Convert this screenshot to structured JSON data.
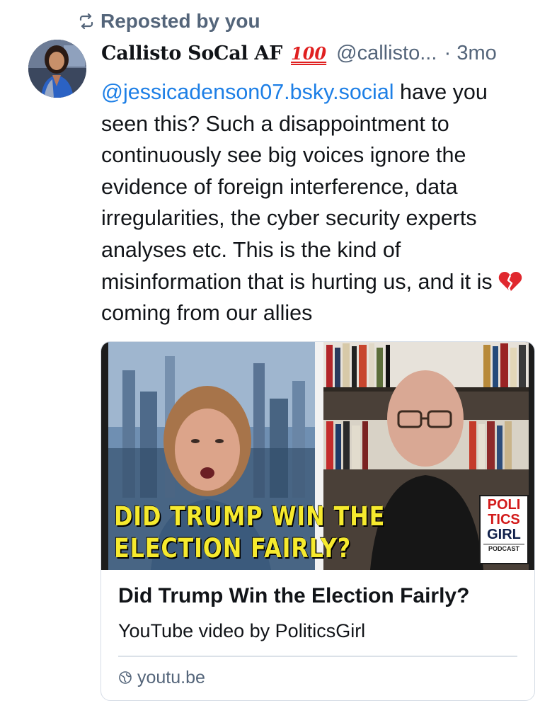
{
  "repost": {
    "label": "Reposted by you",
    "icon": "repost-icon"
  },
  "author": {
    "name": "Callisto SoCal AF",
    "badge": "💯",
    "handle": "@callisto...",
    "separator": "·",
    "timestamp": "3mo"
  },
  "post": {
    "mention": "@jessicadenson07.bsky.social",
    "text_before_emoji": " have you seen this? Such a disappointment to continuously see big voices ignore the evidence of foreign interference, data irregularities, the cyber security experts analyses etc. This is the kind of misinformation that is hurting us, and it is",
    "emoji": "broken-heart-icon",
    "text_after_emoji": "coming from our allies"
  },
  "link_card": {
    "thumbnail": {
      "headline_line1": "DID TRUMP WIN THE",
      "headline_line2": "ELECTION FAIRLY?",
      "logo_line1": "POLI",
      "logo_line2": "TICS",
      "logo_line3": "GIRL",
      "logo_line4": "PODCAST"
    },
    "title": "Did Trump Win the Election Fairly?",
    "description": "YouTube video by PoliticsGirl",
    "domain": "youtu.be",
    "domain_icon": "globe-icon"
  },
  "colors": {
    "link": "#1d7fe6",
    "muted": "#54657a",
    "headline_yellow": "#f6ea2e",
    "badge_red": "#e02020"
  }
}
